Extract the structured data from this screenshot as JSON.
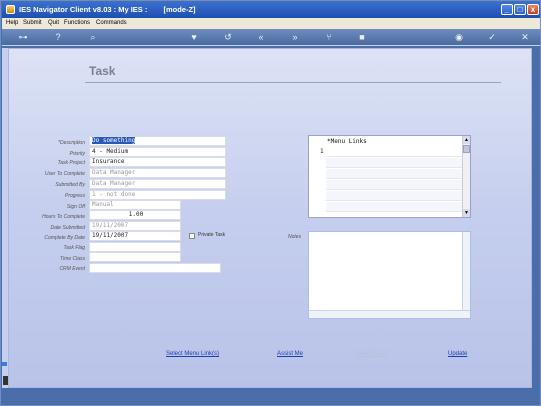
{
  "window": {
    "title": "IES Navigator Client v8.03 : My IES :",
    "mode": "[mode-Z]",
    "controls": {
      "minimize": "_",
      "maximize": "□",
      "close": "x"
    }
  },
  "menubar": [
    "Help",
    "Submit",
    "Quit",
    "Functions",
    "Commands"
  ],
  "toolbar": {
    "icons": [
      "key-icon",
      "help-icon",
      "search-icon",
      "heart-icon",
      "refresh-icon",
      "rewind-icon",
      "fast-forward-icon",
      "tree-icon",
      "stop-icon",
      "globe-icon",
      "check-icon",
      "close-icon"
    ],
    "glyphs": {
      "key": "⊶",
      "help": "?",
      "search": "⌕",
      "heart": "♥",
      "refresh": "↺",
      "back": "«",
      "forward": "»",
      "tree": "⑂",
      "stop": "■",
      "globe": "◉",
      "check": "✓",
      "close": "✕"
    }
  },
  "page": {
    "title": "Task"
  },
  "form": {
    "description": {
      "label": "*Description",
      "value": "Do something"
    },
    "priority": {
      "label": "Priority",
      "value": "4 - Medium"
    },
    "task_project": {
      "label": "Task Project",
      "value": "Insurance"
    },
    "user_to_complete": {
      "label": "User To Complete",
      "value": "Data Manager"
    },
    "submitted_by": {
      "label": "Submitted By",
      "value": "Data Manager"
    },
    "progress": {
      "label": "Progress",
      "value": "1 - not done"
    },
    "sign_off": {
      "label": "Sign Off",
      "value": "Manual"
    },
    "hours_to_complete": {
      "label": "Hours To Complete",
      "value": "1.00"
    },
    "date_submitted": {
      "label": "Date Submitted",
      "value": "19/11/2007"
    },
    "complete_by_date": {
      "label": "Complete By Date",
      "value": "19/11/2007"
    },
    "task_flag": {
      "label": "Task Flag",
      "value": ""
    },
    "time_class": {
      "label": "Time Class",
      "value": ""
    },
    "crm_event": {
      "label": "CRM Event",
      "value": ""
    },
    "private_task": {
      "label": "Private Task",
      "checked": false
    }
  },
  "menu_links": {
    "header": "*Menu Links",
    "row_number": "1",
    "scroll_up": "▲",
    "scroll_down": "▼"
  },
  "notes": {
    "label": "Notes",
    "value": ""
  },
  "actions": {
    "select_menu_links": "Select Menu Link(s)",
    "assist_me": "Assist Me",
    "disabled_action": "View Event",
    "update": "Update"
  }
}
